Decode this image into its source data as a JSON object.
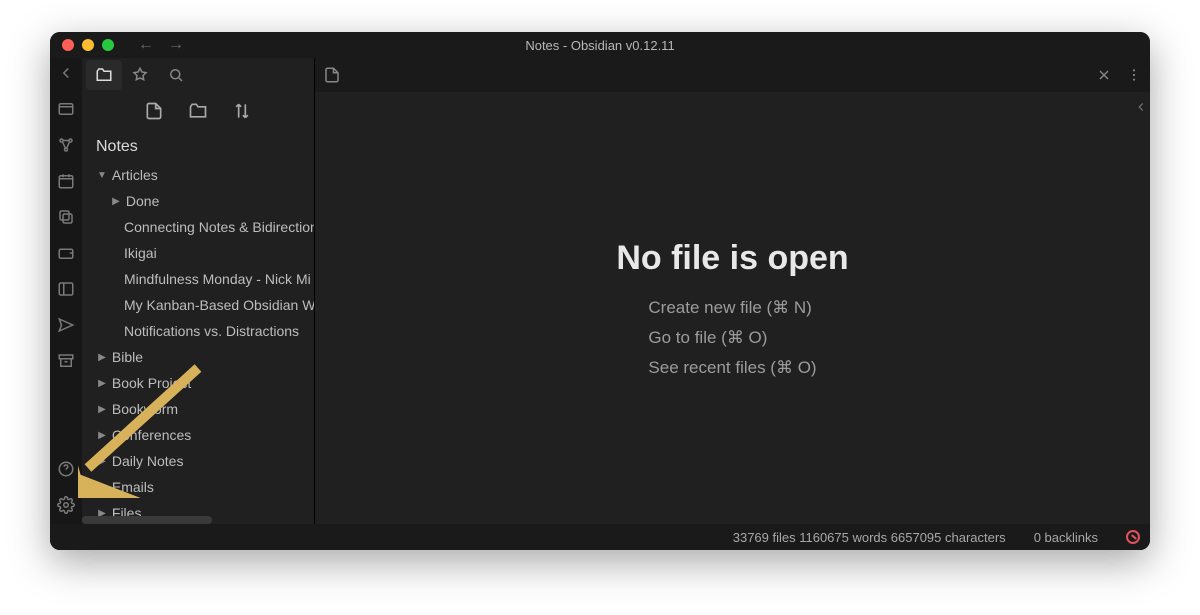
{
  "window_title": "Notes - Obsidian v0.12.11",
  "vault_name": "Notes",
  "tree": {
    "articles": "Articles",
    "done": "Done",
    "i0": "Connecting Notes & Bidirectional",
    "i1": "Ikigai",
    "i2": "Mindfulness Monday - Nick Mi",
    "i3": "My Kanban-Based Obsidian W",
    "i4": "Notifications vs. Distractions",
    "bible": "Bible",
    "book_project": "Book Project",
    "bookworm": "Bookworm",
    "conferences": "Conferences",
    "daily_notes": "Daily Notes",
    "emails": "Emails",
    "files": "Files"
  },
  "empty": {
    "title": "No file is open",
    "act_new": "Create new file (⌘ N)",
    "act_open": "Go to file (⌘ O)",
    "act_recent": "See recent files (⌘ O)"
  },
  "status": {
    "counts": "33769 files 1160675 words 6657095 characters",
    "backlinks": "0 backlinks"
  }
}
